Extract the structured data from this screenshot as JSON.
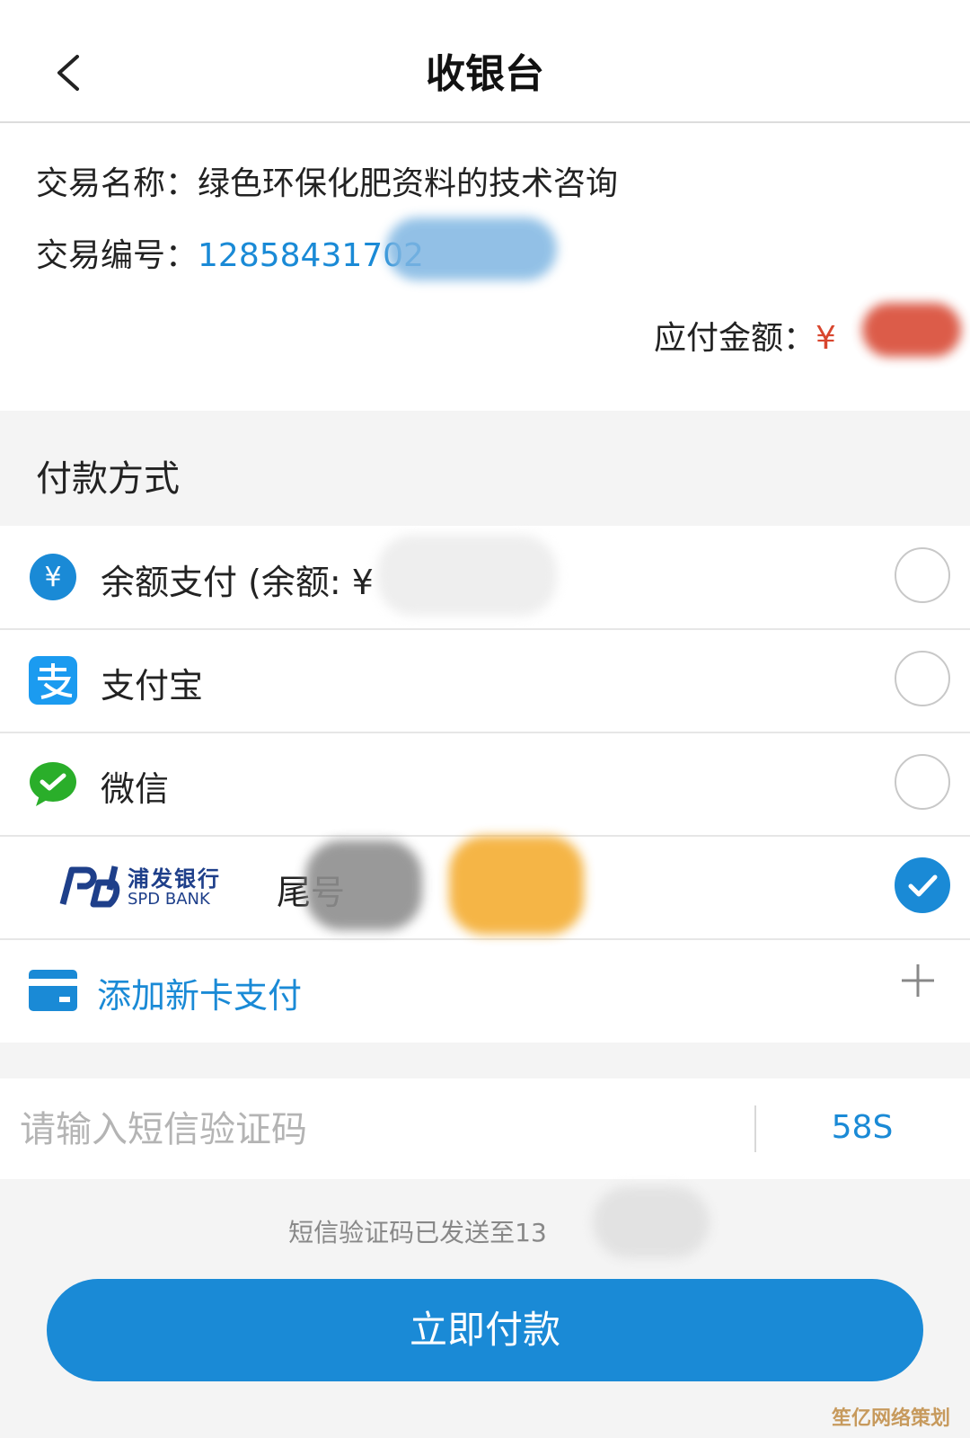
{
  "header": {
    "title": "收银台",
    "back_icon": "chevron-left-icon"
  },
  "transaction": {
    "name_label": "交易名称：",
    "name_value": "绿色环保化肥资料的技术咨询",
    "number_label": "交易编号：",
    "number_value": "12858431702",
    "amount_label": "应付金额：",
    "amount_currency": "¥"
  },
  "payment_section": {
    "title": "付款方式",
    "methods": [
      {
        "label": "余额支付 (余额: ¥",
        "icon": "yen-circle-icon",
        "selected": false
      },
      {
        "label": "支付宝",
        "icon": "alipay-icon",
        "selected": false
      },
      {
        "label": "微信",
        "icon": "wechat-icon",
        "selected": false
      },
      {
        "label": "尾号",
        "bank_name": "浦发银行",
        "bank_name_en": "SPD BANK",
        "icon": "spd-bank-logo",
        "selected": true
      }
    ],
    "add_card_label": "添加新卡支付"
  },
  "sms": {
    "placeholder": "请输入短信验证码",
    "countdown": "58S",
    "hint": "短信验证码已发送至13"
  },
  "pay_button": {
    "label": "立即付款"
  },
  "watermark": "笙亿网络策划",
  "colors": {
    "accent": "#1a8ad6",
    "wechat": "#2aae2a",
    "spd": "#1e3f8a"
  }
}
